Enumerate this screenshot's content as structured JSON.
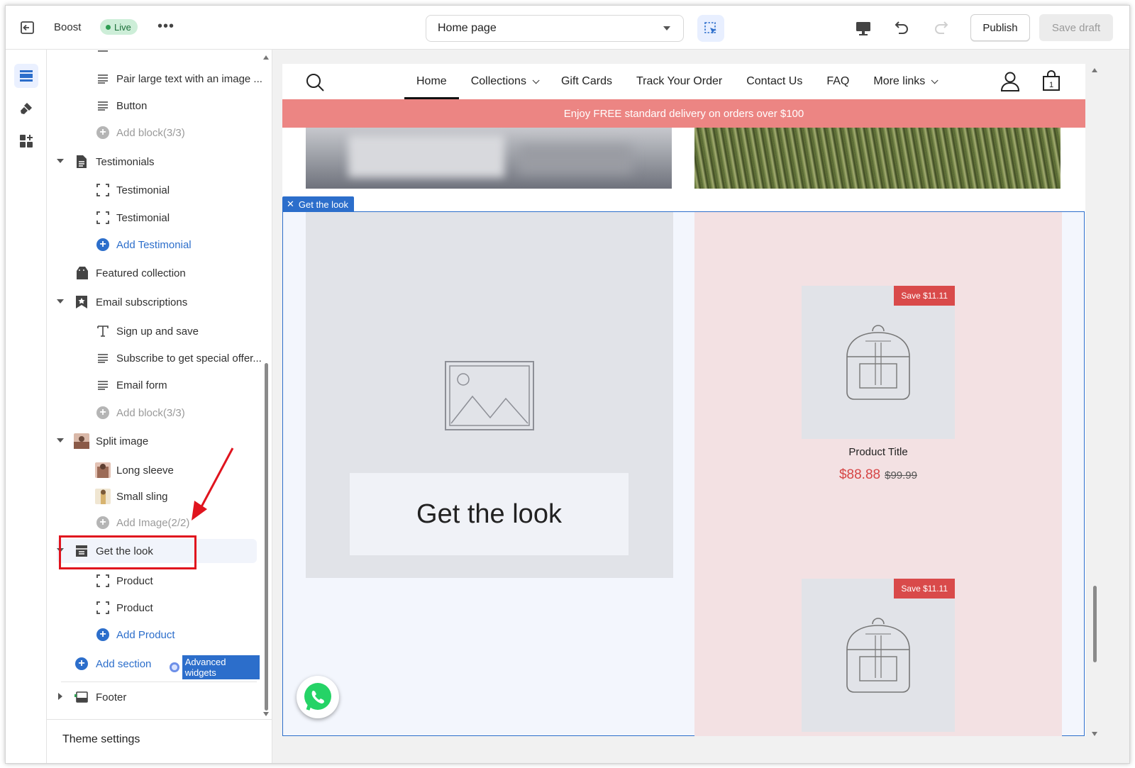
{
  "topbar": {
    "store_name": "Boost",
    "live_label": "Live",
    "page_selector": "Home page",
    "publish_label": "Publish",
    "save_draft_label": "Save draft"
  },
  "rail": {
    "items": [
      "sections-icon",
      "theme-style-icon",
      "app-blocks-icon"
    ]
  },
  "sidebar": {
    "rows": [
      {
        "type": "block",
        "icon": "text-lines-icon",
        "label": "Pair large text with an image ..."
      },
      {
        "type": "block",
        "icon": "text-lines-icon",
        "label": "Button"
      },
      {
        "type": "add-disabled",
        "label": "Add block(3/3)"
      },
      {
        "type": "section",
        "icon": "document-icon",
        "label": "Testimonials",
        "expanded": true
      },
      {
        "type": "block",
        "icon": "bracket-frame-icon",
        "label": "Testimonial"
      },
      {
        "type": "block",
        "icon": "bracket-frame-icon",
        "label": "Testimonial"
      },
      {
        "type": "add",
        "label": "Add Testimonial"
      },
      {
        "type": "section",
        "icon": "collection-tag-icon",
        "label": "Featured collection",
        "expanded": false
      },
      {
        "type": "section",
        "icon": "bookmark-star-icon",
        "label": "Email subscriptions",
        "expanded": true
      },
      {
        "type": "block",
        "icon": "text-t-icon",
        "label": "Sign up and save"
      },
      {
        "type": "block",
        "icon": "text-lines-icon",
        "label": "Subscribe to get special offer..."
      },
      {
        "type": "block",
        "icon": "text-lines-icon",
        "label": "Email form"
      },
      {
        "type": "add-disabled",
        "label": "Add block(3/3)"
      },
      {
        "type": "section",
        "icon": "split-image-thumb-icon",
        "label": "Split image",
        "expanded": true
      },
      {
        "type": "block",
        "icon": "long-sleeve-thumb-icon",
        "label": "Long sleeve"
      },
      {
        "type": "block",
        "icon": "small-sling-thumb-icon",
        "label": "Small sling"
      },
      {
        "type": "add-disabled",
        "label": "Add Image(2/2)"
      },
      {
        "type": "section",
        "icon": "archive-box-icon",
        "label": "Get the look",
        "expanded": true,
        "selected": true
      },
      {
        "type": "block",
        "icon": "bracket-frame-icon",
        "label": "Product"
      },
      {
        "type": "block",
        "icon": "bracket-frame-icon",
        "label": "Product"
      },
      {
        "type": "add",
        "label": "Add Product"
      }
    ],
    "add_section_label": "Add section",
    "advanced_widgets_label": "Advanced widgets",
    "footer_label": "Footer",
    "theme_settings_label": "Theme settings"
  },
  "preview": {
    "nav": {
      "links": [
        "Home",
        "Collections",
        "Gift Cards",
        "Track Your Order",
        "Contact Us",
        "FAQ",
        "More links"
      ],
      "cart_count": "1"
    },
    "announcement": "Enjoy FREE standard delivery on orders over $100",
    "section_tag": "Get the look",
    "get_the_look_title": "Get the look",
    "products": [
      {
        "badge": "Save $11.11",
        "title": "Product Title",
        "price": "$88.88",
        "compare_price": "$99.99"
      },
      {
        "badge": "Save $11.11"
      }
    ]
  },
  "colors": {
    "accent": "#2c6ecb",
    "announcement_bg": "#ec8583",
    "annotation_red": "#e0141e",
    "sale_red": "#d64545"
  }
}
